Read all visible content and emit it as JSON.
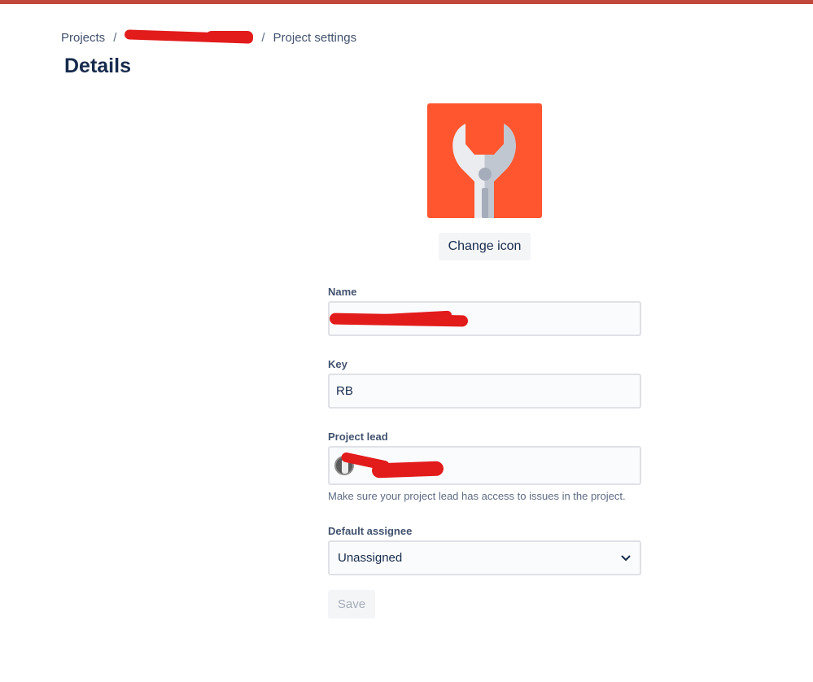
{
  "breadcrumb": {
    "projects_label": "Projects",
    "separator": "/",
    "current_label": "Project settings"
  },
  "page": {
    "title": "Details"
  },
  "project_icon": {
    "icon": "wrench-icon",
    "background_color": "#ff5630"
  },
  "change_icon_button": {
    "label": "Change icon"
  },
  "form": {
    "name": {
      "label": "Name"
    },
    "key": {
      "label": "Key",
      "value": "RB"
    },
    "project_lead": {
      "label": "Project lead",
      "helper": "Make sure your project lead has access to issues in the project."
    },
    "default_assignee": {
      "label": "Default assignee",
      "selected": "Unassigned"
    }
  },
  "save_button": {
    "label": "Save"
  },
  "colors": {
    "top_bar": "#c0473a",
    "redaction": "#e21b1b"
  }
}
